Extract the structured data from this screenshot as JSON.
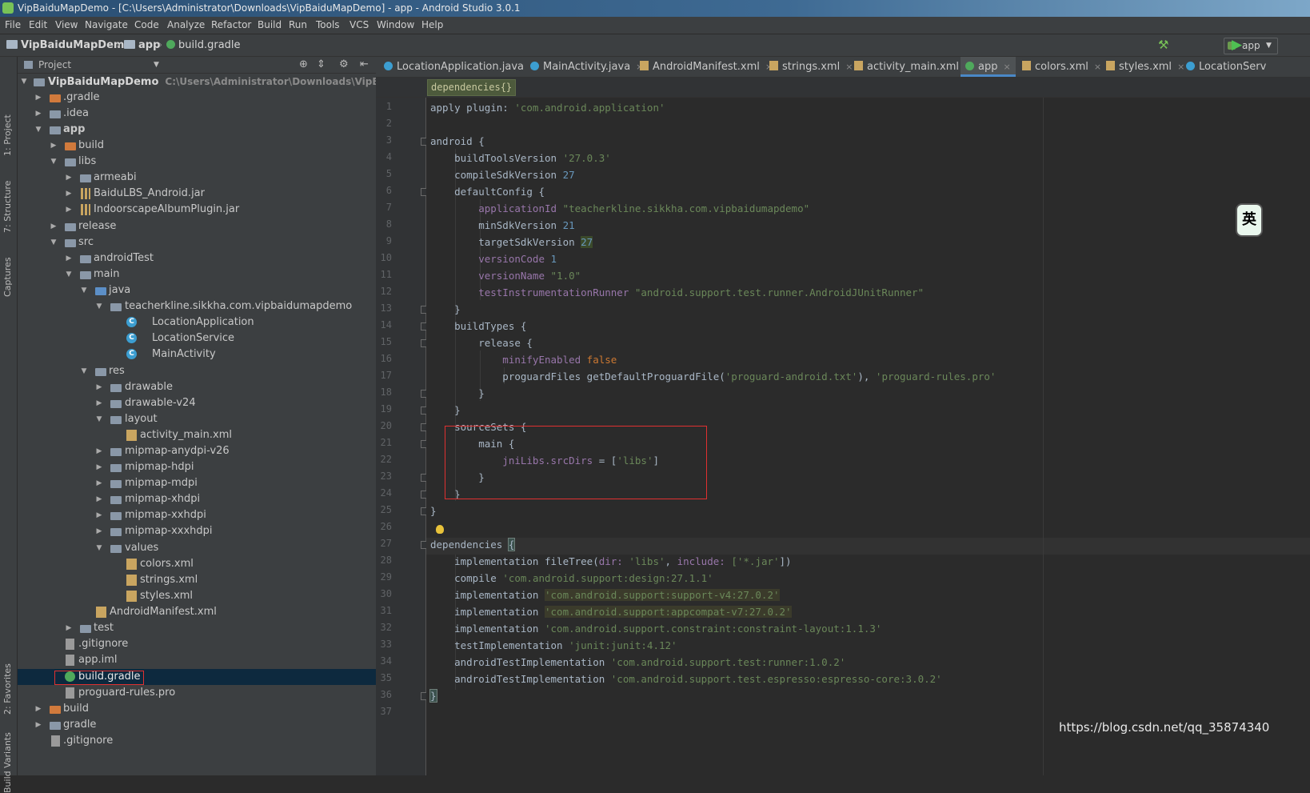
{
  "window": {
    "title": "VipBaiduMapDemo - [C:\\Users\\Administrator\\Downloads\\VipBaiduMapDemo] - app - Android Studio 3.0.1"
  },
  "menu": [
    "File",
    "Edit",
    "View",
    "Navigate",
    "Code",
    "Analyze",
    "Refactor",
    "Build",
    "Run",
    "Tools",
    "VCS",
    "Window",
    "Help"
  ],
  "navbar": {
    "project": "VipBaiduMapDemo",
    "module": "app",
    "file": "build.gradle",
    "run_config": "app"
  },
  "tool_strip": {
    "project": "1: Project",
    "structure": "7: Structure",
    "captures": "Captures",
    "favorites": "2: Favorites",
    "build_variants": "Build Variants"
  },
  "project_panel": {
    "title": "Project",
    "root_name": "VipBaiduMapDemo",
    "root_path": "C:\\Users\\Administrator\\Downloads\\VipBaiduMapDemo",
    "nodes": [
      ".gradle",
      ".idea",
      "app",
      "build",
      "libs",
      "armeabi",
      "BaiduLBS_Android.jar",
      "IndoorscapeAlbumPlugin.jar",
      "release",
      "src",
      "androidTest",
      "main",
      "java",
      "teacherkline.sikkha.com.vipbaidumapdemo",
      "LocationApplication",
      "LocationService",
      "MainActivity",
      "res",
      "drawable",
      "drawable-v24",
      "layout",
      "activity_main.xml",
      "mipmap-anydpi-v26",
      "mipmap-hdpi",
      "mipmap-mdpi",
      "mipmap-xhdpi",
      "mipmap-xxhdpi",
      "mipmap-xxxhdpi",
      "values",
      "colors.xml",
      "strings.xml",
      "styles.xml",
      "AndroidManifest.xml",
      "test",
      ".gitignore",
      "app.iml",
      "build.gradle",
      "proguard-rules.pro",
      "build",
      "gradle",
      ".gitignore"
    ]
  },
  "tabs": [
    "LocationApplication.java",
    "MainActivity.java",
    "AndroidManifest.xml",
    "strings.xml",
    "activity_main.xml",
    "app",
    "colors.xml",
    "styles.xml",
    "LocationServ"
  ],
  "editor_breadcrumb": "dependencies{}",
  "line_numbers": [
    "1",
    "2",
    "3",
    "4",
    "5",
    "6",
    "7",
    "8",
    "9",
    "10",
    "11",
    "12",
    "13",
    "14",
    "15",
    "16",
    "17",
    "18",
    "19",
    "20",
    "21",
    "22",
    "23",
    "24",
    "25",
    "26",
    "27",
    "28",
    "29",
    "30",
    "31",
    "32",
    "33",
    "34",
    "35",
    "36",
    "37"
  ],
  "code": {
    "l1a": "apply plugin: ",
    "l1b": "'com.android.application'",
    "l3": "android {",
    "l4a": "    buildToolsVersion ",
    "l4b": "'27.0.3'",
    "l5a": "    compileSdkVersion ",
    "l5b": "27",
    "l6": "    defaultConfig {",
    "l7a": "        applicationId ",
    "l7b": "\"teacherkline.sikkha.com.vipbaidumapdemo\"",
    "l8a": "        minSdkVersion ",
    "l8b": "21",
    "l9a": "        targetSdkVersion ",
    "l9b": "27",
    "l10a": "        versionCode ",
    "l10b": "1",
    "l11a": "        versionName ",
    "l11b": "\"1.0\"",
    "l12a": "        testInstrumentationRunner ",
    "l12b": "\"android.support.test.runner.AndroidJUnitRunner\"",
    "l13": "    }",
    "l14": "    buildTypes {",
    "l15": "        release {",
    "l16a": "            minifyEnabled ",
    "l16b": "false",
    "l17a": "            proguardFiles getDefaultProguardFile(",
    "l17b": "'proguard-android.txt'",
    "l17c": "), ",
    "l17d": "'proguard-rules.pro'",
    "l18": "        }",
    "l19": "    }",
    "l20": "    sourceSets {",
    "l21": "        main {",
    "l22a": "            jniLibs.srcDirs",
    "l22b": " = [",
    "l22c": "'libs'",
    "l22d": "]",
    "l23": "        }",
    "l24": "    }",
    "l25": "}",
    "l27a": "dependencies ",
    "l27b": "{",
    "l28a": "    implementation fileTree(",
    "l28b": "dir: ",
    "l28c": "'libs'",
    "l28d": ", ",
    "l28e": "include: ",
    "l28f": "['*.jar'",
    "l28g": "])",
    "l29a": "    compile ",
    "l29b": "'com.android.support:design:27.1.1'",
    "l30a": "    implementation ",
    "l30b": "'com.android.support:support-v4:27.0.2'",
    "l31a": "    implementation ",
    "l31b": "'com.android.support:appcompat-v7:27.0.2'",
    "l32a": "    implementation ",
    "l32b": "'com.android.support.constraint:constraint-layout:1.1.3'",
    "l33a": "    testImplementation ",
    "l33b": "'junit:junit:4.12'",
    "l34a": "    androidTestImplementation ",
    "l34b": "'com.android.support.test:runner:1.0.2'",
    "l35a": "    androidTestImplementation ",
    "l35b": "'com.android.support.test.espresso:espresso-core:3.0.2'",
    "l36": "}"
  },
  "ime_badge": "英",
  "watermark": "https://blog.csdn.net/qq_35874340",
  "colors": {
    "background": "#2b2b2b",
    "panel": "#3c3f41",
    "selection": "#0d293e",
    "string": "#6a8759",
    "number": "#6897bb",
    "property": "#9876aa",
    "keyword": "#cc7832",
    "highlight_box": "#e03030"
  }
}
